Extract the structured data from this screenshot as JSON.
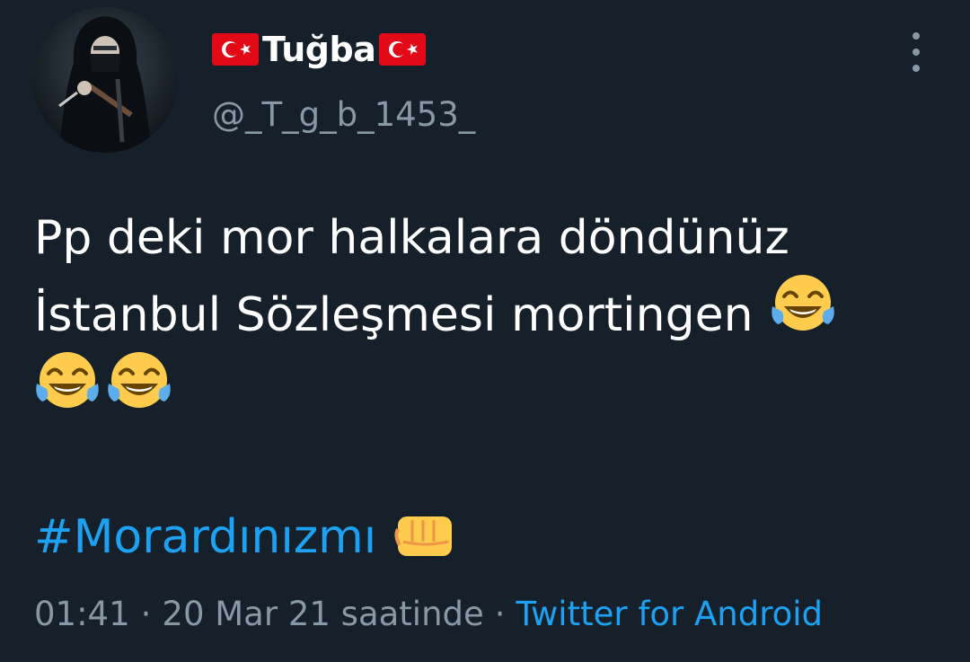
{
  "user": {
    "display_name": "Tuğba",
    "handle": "@_T_g_b_1453_",
    "flag_icon": "turkey-flag-icon",
    "avatar_icon": "hooded-figure-avatar"
  },
  "menu_icon": "more-vertical-icon",
  "tweet": {
    "line1": "Pp deki mor halkalara döndünüz",
    "line2": "İstanbul Sözleşmesi mortingen",
    "emoji": "face-with-tears-of-joy",
    "hashtag": "#Morardınızmı",
    "hashtag_emoji": "oncoming-fist"
  },
  "meta": {
    "time": "01:41",
    "separator": "·",
    "date": "20 Mar 21 saatinde",
    "source": "Twitter for Android"
  },
  "colors": {
    "background": "#15202b",
    "link": "#1da1f2",
    "secondary_text": "#8899a6",
    "flag_red": "#e30a17"
  }
}
